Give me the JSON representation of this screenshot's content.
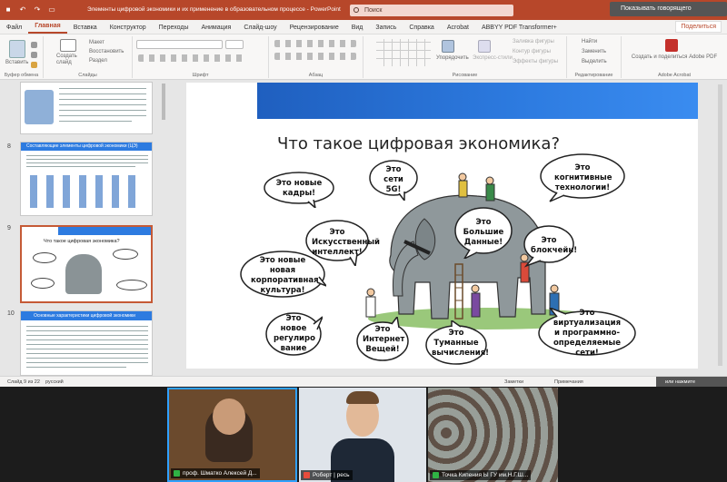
{
  "titlebar": {
    "doc_title": "Элементы цифровой экономики и их применение в образовательном процессе - PowerPoint",
    "search_placeholder": "Поиск",
    "overlay_text": "Показывать говорящего"
  },
  "ribbon_tabs": [
    "Файл",
    "Главная",
    "Вставка",
    "Конструктор",
    "Переходы",
    "Анимация",
    "Слайд-шоу",
    "Рецензирование",
    "Вид",
    "Запись",
    "Справка",
    "Acrobat",
    "ABBYY PDF Transformer+"
  ],
  "share_label": "Поделиться",
  "ribbon": {
    "clipboard": {
      "paste": "Вставить",
      "label": "Буфер обмена"
    },
    "slides": {
      "new_slide": "Создать слайд",
      "layout": "Макет",
      "reset": "Восстановить",
      "section": "Раздел",
      "label": "Слайды"
    },
    "font": {
      "label": "Шрифт"
    },
    "paragraph": {
      "label": "Абзац"
    },
    "drawing": {
      "arrange": "Упорядочить",
      "quick_styles": "Экспресс-стили",
      "fill": "Заливка фигуры",
      "outline": "Контур фигуры",
      "effects": "Эффекты фигуры",
      "label": "Рисование"
    },
    "editing": {
      "find": "Найти",
      "replace": "Заменить",
      "select": "Выделить",
      "label": "Редактирование"
    },
    "acrobat": {
      "create": "Создать и поделиться Adobe PDF",
      "label": "Adobe Acrobat"
    }
  },
  "thumbnails": [
    {
      "number": "8",
      "title": "Составляющие элементы цифровой экономики (ЦЭ)"
    },
    {
      "number": "9",
      "title": "Что такое цифровая экономика?"
    },
    {
      "number": "10",
      "title": "Основные характеристики цифровой экономики"
    }
  ],
  "slide": {
    "title": "Что такое цифровая экономика?",
    "bubbles": [
      "Это новые кадры!",
      "Это сети 5G!",
      "Это когнитивные технологии!",
      "Это Искусственный интеллект!",
      "Это Большие Данные!",
      "Это блокчейн!",
      "Это новые новая корпоративная культура!",
      "Это новое регулиро вание",
      "Это Интернет Вещей!",
      "Это Туманные вычисления!",
      "Это виртуализация и программно-определяемые сети!"
    ]
  },
  "statusbar": {
    "slide_info": "Слайд 9 из 22",
    "language": "русский",
    "notes": "Заметки",
    "comments": "Примечания",
    "overlay": "или нажмите"
  },
  "participants": [
    {
      "name": "проф. Шматко Алексей Д..."
    },
    {
      "name": "Роберт | ресь"
    },
    {
      "name": "Точка Кипения Ы ГУ им.Н.Г.Ш..."
    }
  ],
  "colors": {
    "accent": "#b7472a",
    "banner": "#2d7be0",
    "active_speaker": "#2fa0ff"
  }
}
